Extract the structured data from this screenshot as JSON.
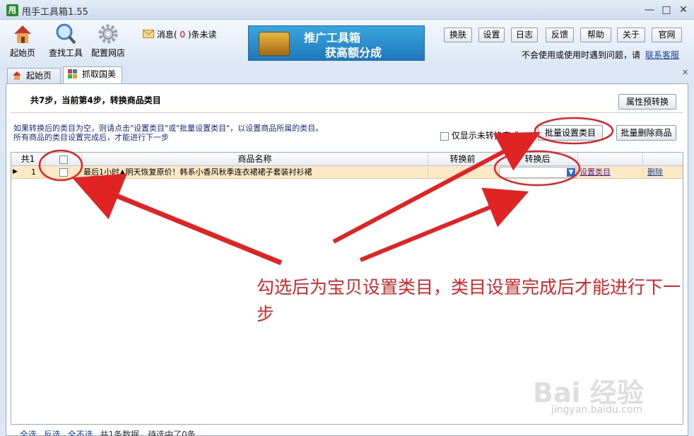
{
  "window": {
    "logo": "甩",
    "title": "甩手工具箱1.55",
    "minimize_glyph": "—",
    "maximize_glyph": "□",
    "close_glyph": "✕"
  },
  "toolbar": {
    "home_label": "起始页",
    "find_tools_label": "查找工具",
    "config_store_label": "配置网店",
    "message_prefix": "消息(",
    "message_count": "0",
    "message_suffix": ")条未读",
    "banner_line1": "推广工具箱",
    "banner_line2": "获高额分成",
    "buttons": [
      "换肤",
      "设置",
      "日志",
      "反馈",
      "帮助",
      "关于",
      "官网"
    ],
    "help_text": "不会使用或使用时遇到问题，请",
    "help_link": "联系客服"
  },
  "tabs": [
    {
      "label": "起始页",
      "icon": "home-icon"
    },
    {
      "label": "抓取国美",
      "icon": "gome-icon"
    }
  ],
  "tab_close_glyph": "✕",
  "step": {
    "title": "共7步，当前第4步，转换商品类目",
    "attr_preconvert_button": "属性预转换"
  },
  "info": {
    "line1": "如果转换后的类目为空，则请点击\"设置类目\"或\"批量设置类目\"，以设置商品所属的类目。",
    "line2": "所有商品的类目设置完成后，才能进行下一步"
  },
  "options": {
    "only_unconverted_label": "仅显示未转换完成",
    "batch_set_category_button": "批量设置类目",
    "batch_delete_button": "批量删除商品"
  },
  "grid": {
    "columns": [
      "共1",
      "",
      "商品名称",
      "转换前",
      "转换后",
      "",
      ""
    ],
    "rows": [
      {
        "indicator": "▶",
        "index": "1",
        "name": "最后1小时▲明天恢复原价！韩系小香风秋季连衣裙裙子套装衬衫裙",
        "before": "",
        "after": "",
        "set_category": "设置类目",
        "delete": "删除"
      }
    ]
  },
  "annotation": {
    "text": "勾选后为宝贝设置类目，类目设置完成后才能进行下一步",
    "color": "#d2282a"
  },
  "status_bar": {
    "select_all": "全选",
    "invert": "反选",
    "select_none": "全不选",
    "summary": "共1条数据，待选中了0条"
  },
  "watermark": {
    "brand": "Bai 经验",
    "url": "jingyan.baidu.com"
  },
  "colors": {
    "accent": "#3169c6",
    "row_highlight": "#fde9c6",
    "annotation_red": "#d2282a"
  }
}
